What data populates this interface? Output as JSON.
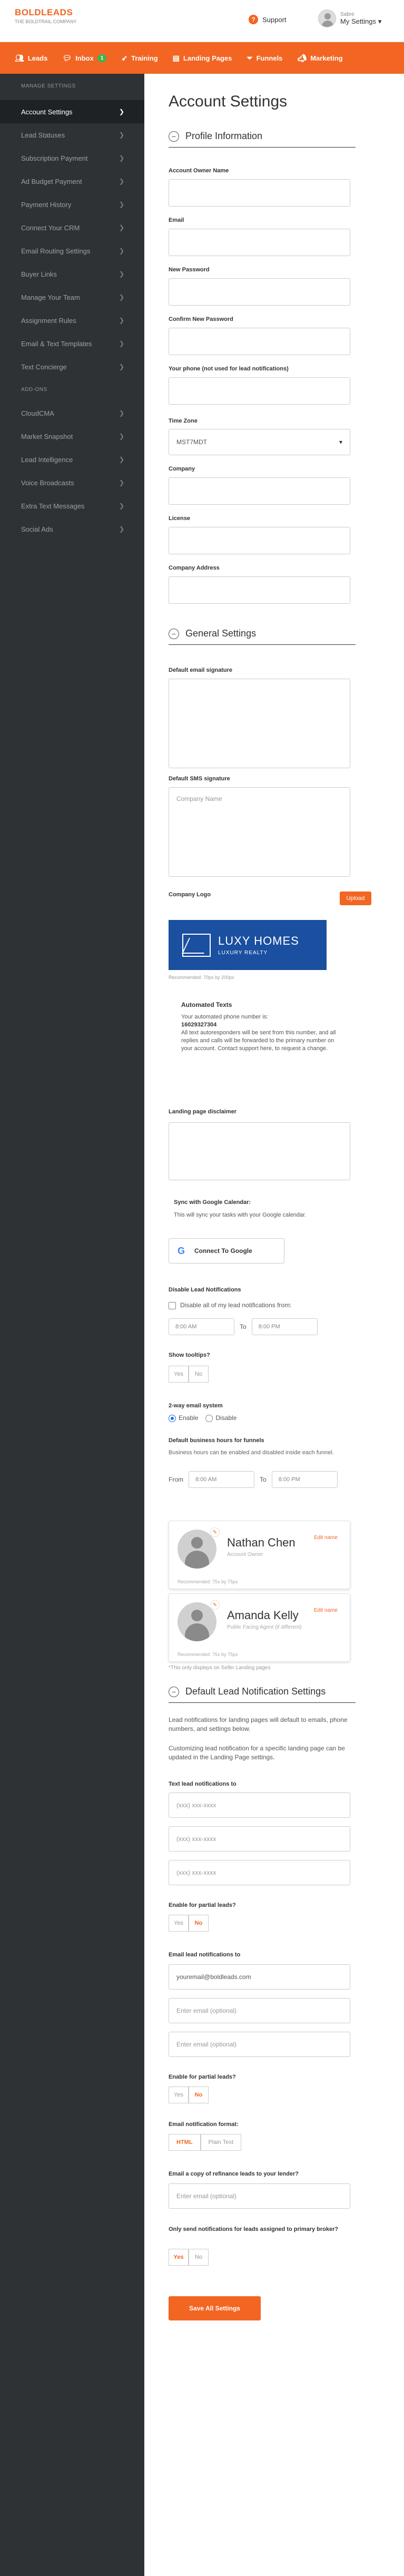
{
  "header": {
    "logo": "BOLDLEADS",
    "logo_sub": "THE BOLDTRAIL COMPANY",
    "support_label": "Support",
    "user_name": "Sabre",
    "user_menu_label": "My Settings"
  },
  "nav": {
    "items": [
      {
        "label": "Leads",
        "icon": "users-icon"
      },
      {
        "label": "Inbox",
        "icon": "chat-icon",
        "badge": "1"
      },
      {
        "label": "Training",
        "icon": "rocket-icon"
      },
      {
        "label": "Landing Pages",
        "icon": "page-icon"
      },
      {
        "label": "Funnels",
        "icon": "funnel-icon"
      },
      {
        "label": "Marketing",
        "icon": "megaphone-icon"
      }
    ]
  },
  "sidebar": {
    "heading": "MANAGE SETTINGS",
    "items": [
      {
        "label": "Account Settings",
        "active": true
      },
      {
        "label": "Lead Statuses"
      },
      {
        "label": "Subscription Payment"
      },
      {
        "label": "Ad Budget Payment"
      },
      {
        "label": "Payment History"
      },
      {
        "label": "Connect Your CRM"
      },
      {
        "label": "Email Routing Settings"
      },
      {
        "label": "Buyer Links"
      },
      {
        "label": "Manage Your Team"
      },
      {
        "label": "Assignment Rules"
      },
      {
        "label": "Email & Text Templates"
      },
      {
        "label": "Text Concierge"
      }
    ],
    "addons_heading": "ADD-ONS",
    "addons": [
      {
        "label": "CloudCMA"
      },
      {
        "label": "Market Snapshot"
      },
      {
        "label": "Lead Intelligence"
      },
      {
        "label": "Voice Broadcasts"
      },
      {
        "label": "Extra Text Messages"
      },
      {
        "label": "Social Ads"
      }
    ]
  },
  "main": {
    "title": "Account Settings",
    "profile": {
      "heading": "Profile Information",
      "owner_name_label": "Account Owner Name",
      "email_label": "Email",
      "new_password_label": "New Password",
      "confirm_password_label": "Confirm New Password",
      "phone_label": "Your phone (not used for lead notifications)",
      "timezone_label": "Time Zone",
      "timezone_value": "MST7MDT",
      "company_label": "Company",
      "license_label": "License",
      "company_address_label": "Company Address"
    },
    "general": {
      "heading": "General Settings",
      "email_signature_label": "Default email signature",
      "sms_signature_label": "Default SMS signature",
      "sms_signature_placeholder": "Company Name",
      "company_logo_label": "Company Logo",
      "upload_label": "Upload",
      "logo_line1": "LUXY HOMES",
      "logo_line2": "LUXURY REALTY",
      "logo_recommended": "Recommended: 70px by 200px",
      "automated_texts_title": "Automated Texts",
      "automated_texts_intro": "Your automated phone number is:",
      "automated_texts_number": "16029327304",
      "automated_texts_body": "All text autoresponders will be sent from this number, and all replies and calls will be forwarded to the primary number on your account. Contact support here, to request a change.",
      "disclaimer_label": "Landing page disclaimer",
      "google_sync_title": "Sync with Google Calendar:",
      "google_sync_desc": "This will sync your tasks with your Google calendar.",
      "google_button": "Connect To Google",
      "disable_notif_label": "Disable Lead Notifications",
      "disable_notif_check": "Disable all of my lead notifications from:",
      "disable_from": "8:00 AM",
      "to_label": "To",
      "disable_to": "8:00 PM",
      "show_tooltips_label": "Show tooltips?",
      "yes": "Yes",
      "no": "No",
      "two_way_label": "2-way email system",
      "enable_label": "Enable",
      "disable_label": "Disable",
      "business_hours_label": "Default business hours for funnels",
      "business_hours_desc": "Business hours can be enabled and disabled inside each funnel.",
      "from_label": "From",
      "hours_from": "8:00 AM",
      "hours_to": "8:00 PM",
      "cards": [
        {
          "name": "Nathan Chen",
          "role": "Account Owner",
          "edit": "Edit name",
          "rec": "Recommended: 75x by 75px"
        },
        {
          "name": "Amanda Kelly",
          "role": "Public Facing Agent (if different)",
          "edit": "Edit name",
          "rec": "Recommended: 75x by 75px"
        }
      ],
      "cards_note": "*This only displays on Seller Landing pages"
    },
    "lead_notif": {
      "heading": "Default Lead Notification Settings",
      "para1": "Lead notifications for landing pages will default to emails, phone numbers, and settings below.",
      "para2": "Customizing lead notification for a specific landing page can be updated in the Landing Page settings.",
      "text_to_label": "Text lead notifications to",
      "phone_placeholder": "(xxx) xxx-xxxx",
      "partial_label": "Enable for partial leads?",
      "email_to_label": "Email lead notifications to",
      "email_value": "youremail@boldleads.com",
      "email_optional": "Enter email (optional)",
      "format_label": "Email notification format:",
      "format_html": "HTML",
      "format_plain": "Plain Text",
      "lender_label": "Email a copy of refinance leads to your lender?",
      "primary_only_label": "Only send notifications for leads assigned to primary broker?",
      "save_label": "Save All Settings"
    }
  },
  "colors": {
    "brand": "#f26522",
    "sidebar": "#2e3234",
    "logo_bg": "#1b4fa0"
  }
}
